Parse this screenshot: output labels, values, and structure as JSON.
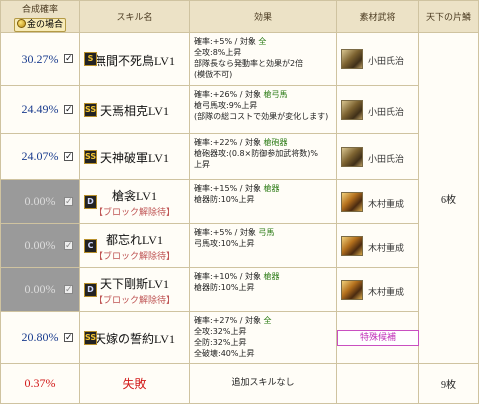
{
  "header": {
    "rate": "合成確率",
    "gold_case": "金の場合",
    "skill_name": "スキル名",
    "effect": "効果",
    "material": "素材武将",
    "shards": "天下の片鱗"
  },
  "rows": [
    {
      "rate": "30.27%",
      "rank": "S",
      "name": "無間不死鳥LV1",
      "note": "",
      "effect": [
        "確率:+5% / 対象 ",
        "全"
      ],
      "effect_rest": [
        "全攻:8%上昇",
        "部隊長なら発動率と効果が2倍",
        "(模倣不可)"
      ],
      "material": "小田氏治"
    },
    {
      "rate": "24.49%",
      "rank": "SS",
      "name": "天焉相克LV1",
      "note": "",
      "effect": [
        "確率:+26% / 対象 ",
        "槍弓馬"
      ],
      "effect_rest": [
        "槍弓馬攻:9%上昇",
        "(部隊の総コストで効果が変化します)"
      ],
      "material": "小田氏治"
    },
    {
      "rate": "24.07%",
      "rank": "SS",
      "name": "天神破軍LV1",
      "note": "",
      "effect": [
        "確率:+22% / 対象 ",
        "槍砲器"
      ],
      "effect_rest": [
        "槍砲器攻:(0.8×防御参加武将数)%",
        "上昇"
      ],
      "material": "小田氏治"
    },
    {
      "rate": "0.00%",
      "rank": "D",
      "name": "槍衾LV1",
      "note": "【ブロック解除待】",
      "effect": [
        "確率:+15% / 対象 ",
        "槍器"
      ],
      "effect_rest": [
        "槍器防:10%上昇"
      ],
      "material": "木村重成"
    },
    {
      "rate": "0.00%",
      "rank": "C",
      "name": "都忘れLV1",
      "note": "【ブロック解除待】",
      "effect": [
        "確率:+5% / 対象 ",
        "弓馬"
      ],
      "effect_rest": [
        "弓馬攻:10%上昇"
      ],
      "material": "木村重成"
    },
    {
      "rate": "0.00%",
      "rank": "D",
      "name": "天下剛斯LV1",
      "note": "【ブロック解除待】",
      "effect": [
        "確率:+10% / 対象 ",
        "槍器"
      ],
      "effect_rest": [
        "槍器防:10%上昇"
      ],
      "material": "木村重成"
    },
    {
      "rate": "20.80%",
      "rank": "SS",
      "name": "天嫁の誓約LV1",
      "note": "",
      "effect": [
        "確率:+27% / 対象 ",
        "全"
      ],
      "effect_rest": [
        "全攻:32%上昇",
        "全防:32%上昇",
        "全破壊:40%上昇"
      ],
      "material": "特殊候補"
    }
  ],
  "fail_row": {
    "rate": "0.37%",
    "label": "失敗",
    "effect": "追加スキルなし",
    "shards": "9枚"
  },
  "shards_main": "6枚",
  "check_mark": "✓"
}
